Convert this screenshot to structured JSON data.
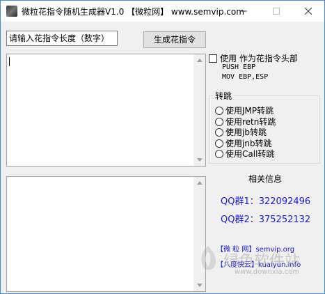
{
  "window": {
    "title": "微粒花指令随机生成器V1.0  【微粒网】  www.semvip.com",
    "controls": {
      "minimize": "minimize-icon",
      "maximize": "maximize-icon",
      "close": "close-icon"
    }
  },
  "toolbar": {
    "length_input_value": "请输入花指令长度（数字）",
    "generate_button": "生成花指令"
  },
  "header_option": {
    "checkbox_label": "使用  作为花指令头部",
    "checked": false,
    "code_lines": [
      "PUSH EBP",
      "MOV EBP,ESP"
    ]
  },
  "jump_group": {
    "title": "转跳",
    "options": [
      "使用JMP转跳",
      "使用retn转跳",
      "使用jb转跳",
      "使用jnb转跳",
      "使用Call转跳"
    ]
  },
  "info": {
    "title": "相关信息",
    "qq1": "QQ群1：322092496",
    "qq2": "QQ群2：375252132",
    "link1": "【微 粒 网】semvip.org",
    "link2": "【八度快云】kuaiyun.info"
  },
  "watermark": {
    "text": "绿色软件站",
    "url": "www.downxia.com"
  }
}
